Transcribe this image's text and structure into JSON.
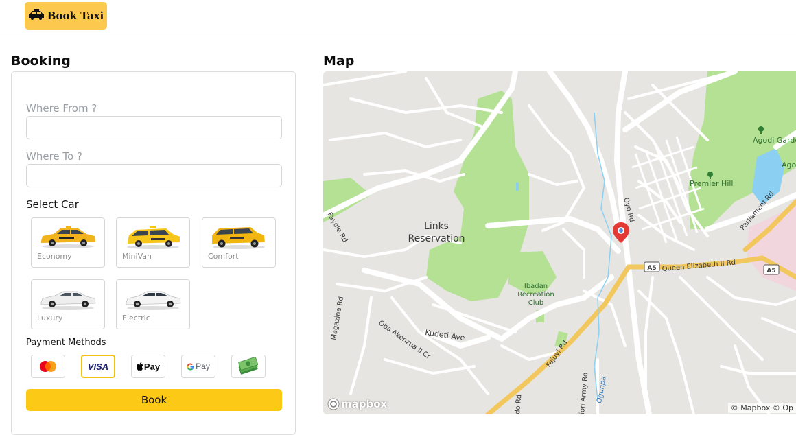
{
  "header": {
    "logo_text": "Book Taxi",
    "logo_icon": "taxi-icon"
  },
  "booking": {
    "title": "Booking",
    "from_label": "Where From ?",
    "from_value": "",
    "to_label": "Where To ?",
    "to_value": "",
    "select_car_label": "Select Car",
    "cars": [
      {
        "name": "Economy",
        "color": "#f2b41d"
      },
      {
        "name": "MiniVan",
        "color": "#f6c61a"
      },
      {
        "name": "Comfort",
        "color": "#f0b60f"
      },
      {
        "name": "Luxury",
        "color": "#eeeeee"
      },
      {
        "name": "Electric",
        "color": "#f4f4f4"
      }
    ],
    "payment_label": "Payment Methods",
    "payment_methods": [
      {
        "name": "mastercard-icon",
        "selected": false
      },
      {
        "name": "visa-icon",
        "label": "VISA",
        "selected": true
      },
      {
        "name": "apple-pay-icon",
        "label": "Pay",
        "selected": false
      },
      {
        "name": "google-pay-icon",
        "label": "Pay",
        "selected": false
      },
      {
        "name": "cash-icon",
        "selected": false
      }
    ],
    "book_label": "Book",
    "accent_color": "#fcc916"
  },
  "map": {
    "title": "Map",
    "labels": {
      "links": "Links",
      "reservation": "Reservation",
      "agodi_gardens": "Agodi Gardens",
      "agodi_partial": "Agod",
      "premier_hill": "Premier Hill",
      "ibadan_recreation_1": "Ibadan",
      "ibadan_recreation_2": "Recreation",
      "ibadan_recreation_3": "Club",
      "oyo_rd": "Oyo Rd",
      "queen_elizabeth": "Queen Elizabeth II Rd",
      "a5_a": "A5",
      "a5_b": "A5",
      "parliament": "Parliament Rd",
      "magazine": "Magazine Rd",
      "oba_akenzua": "Oba Akenzua II Cr",
      "kudeti": "Kudeti Ave",
      "fajuyi": "Fajuyi Rd",
      "army": "ion Army Rd",
      "ogunpa": "Ogunpa",
      "fayele": "Fayele Rd",
      "do_rd": "do Rd"
    },
    "mapbox_logo": "mapbox",
    "attribution": "© Mapbox © Op"
  }
}
